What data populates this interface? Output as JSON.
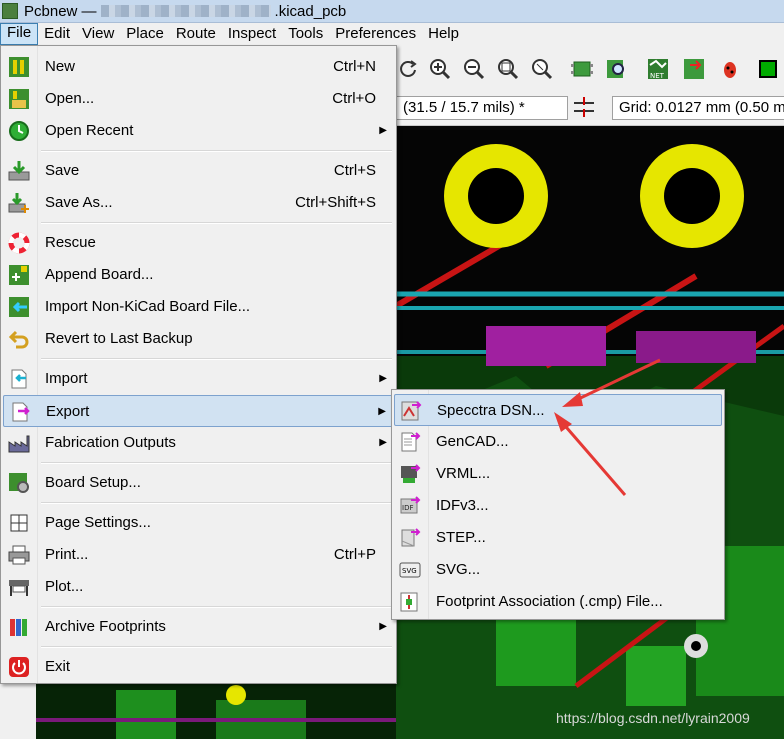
{
  "window": {
    "title_prefix": "Pcbnew —",
    "title_suffix": ".kicad_pcb"
  },
  "menubar": [
    "File",
    "Edit",
    "View",
    "Place",
    "Route",
    "Inspect",
    "Tools",
    "Preferences",
    "Help"
  ],
  "toolbar": {
    "track_width": "(31.5 / 15.7 mils) *",
    "grid": "Grid: 0.0127 mm (0.50 m"
  },
  "file_menu": [
    {
      "label": "New",
      "shortcut": "Ctrl+N",
      "icon": "new-board-icon"
    },
    {
      "label": "Open...",
      "shortcut": "Ctrl+O",
      "icon": "open-board-icon"
    },
    {
      "label": "Open Recent",
      "shortcut": "",
      "submenu": true,
      "icon": "recent-clock-icon"
    },
    {
      "label": "Save",
      "shortcut": "Ctrl+S",
      "icon": "save-icon"
    },
    {
      "label": "Save As...",
      "shortcut": "Ctrl+Shift+S",
      "icon": "save-as-icon"
    },
    {
      "label": "Rescue",
      "shortcut": "",
      "icon": "rescue-lifebuoy-icon"
    },
    {
      "label": "Append Board...",
      "shortcut": "",
      "icon": "append-board-icon"
    },
    {
      "label": "Import Non-KiCad Board File...",
      "shortcut": "",
      "icon": "import-board-icon"
    },
    {
      "label": "Revert to Last Backup",
      "shortcut": "",
      "icon": "revert-icon"
    },
    {
      "label": "Import",
      "shortcut": "",
      "submenu": true,
      "icon": "import-icon"
    },
    {
      "label": "Export",
      "shortcut": "",
      "submenu": true,
      "icon": "export-icon"
    },
    {
      "label": "Fabrication Outputs",
      "shortcut": "",
      "submenu": true,
      "icon": "factory-icon"
    },
    {
      "label": "Board Setup...",
      "shortcut": "",
      "icon": "board-setup-icon"
    },
    {
      "label": "Page Settings...",
      "shortcut": "",
      "icon": "page-settings-icon"
    },
    {
      "label": "Print...",
      "shortcut": "Ctrl+P",
      "icon": "printer-icon"
    },
    {
      "label": "Plot...",
      "shortcut": "",
      "icon": "plotter-icon"
    },
    {
      "label": "Archive Footprints",
      "shortcut": "",
      "submenu": true,
      "icon": "library-books-icon"
    },
    {
      "label": "Exit",
      "shortcut": "",
      "icon": "exit-power-icon"
    }
  ],
  "export_menu": [
    {
      "label": "Specctra DSN...",
      "icon": "specctra-dsn-icon"
    },
    {
      "label": "GenCAD...",
      "icon": "gencad-icon"
    },
    {
      "label": "VRML...",
      "icon": "vrml-icon"
    },
    {
      "label": "IDFv3...",
      "icon": "idf-icon"
    },
    {
      "label": "STEP...",
      "icon": "step-icon"
    },
    {
      "label": "SVG...",
      "icon": "svg-icon"
    },
    {
      "label": "Footprint Association (.cmp) File...",
      "icon": "footprint-association-icon"
    }
  ],
  "watermark": "https://blog.csdn.net/lyrain2009",
  "colors": {
    "menu_bg": "#f0f0f0",
    "highlight": "#d1e2f2",
    "highlight_border": "#7da2ce",
    "pad_yellow": "#e6e600",
    "track_red": "#c81414",
    "arrow": "#e53935"
  }
}
